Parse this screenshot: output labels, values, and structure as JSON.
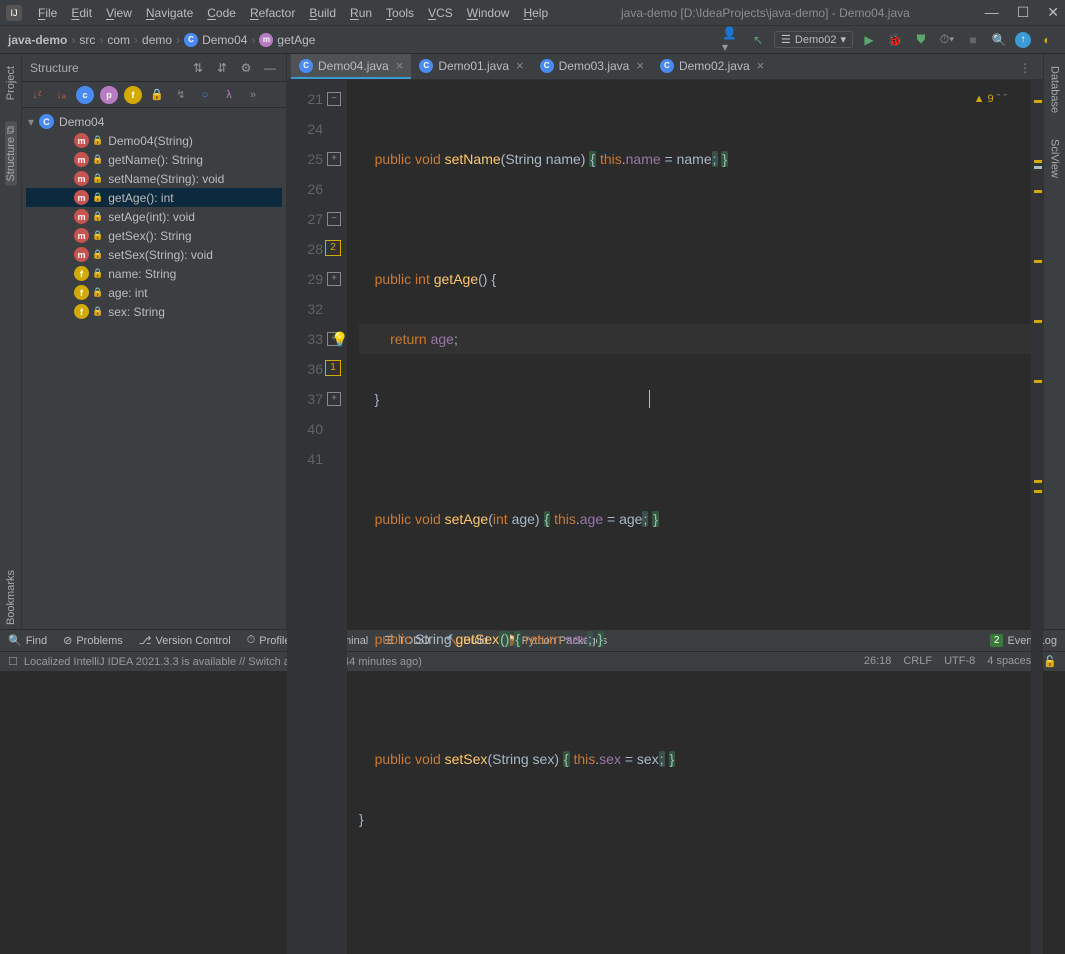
{
  "app": {
    "title": "java-demo [D:\\IdeaProjects\\java-demo] - Demo04.java"
  },
  "menu": [
    "File",
    "Edit",
    "View",
    "Navigate",
    "Code",
    "Refactor",
    "Build",
    "Run",
    "Tools",
    "VCS",
    "Window",
    "Help"
  ],
  "breadcrumb": {
    "project": "java-demo",
    "parts": [
      "src",
      "com",
      "demo"
    ],
    "class": "Demo04",
    "method": "getAge"
  },
  "runconfig": "Demo02",
  "warn_count": "9",
  "structure": {
    "title": "Structure",
    "class": "Demo04",
    "members": [
      {
        "t": "m",
        "label": "Demo04(String)"
      },
      {
        "t": "m",
        "label": "getName(): String"
      },
      {
        "t": "m",
        "label": "setName(String): void"
      },
      {
        "t": "m",
        "label": "getAge(): int",
        "sel": true
      },
      {
        "t": "m",
        "label": "setAge(int): void"
      },
      {
        "t": "m",
        "label": "getSex(): String"
      },
      {
        "t": "m",
        "label": "setSex(String): void"
      },
      {
        "t": "f",
        "label": "name: String"
      },
      {
        "t": "f",
        "label": "age: int"
      },
      {
        "t": "f",
        "label": "sex: String"
      }
    ]
  },
  "tabs": [
    {
      "name": "Demo04.java",
      "active": true
    },
    {
      "name": "Demo01.java"
    },
    {
      "name": "Demo03.java"
    },
    {
      "name": "Demo02.java"
    }
  ],
  "lines": [
    "21",
    "24",
    "25",
    "26",
    "27",
    "28",
    "29",
    "32",
    "33",
    "36",
    "37",
    "40",
    "41"
  ],
  "bottom": [
    "Find",
    "Problems",
    "Version Control",
    "Profiler",
    "Terminal",
    "TODO",
    "Build",
    "Python Packages"
  ],
  "eventlog": {
    "count": "2",
    "label": "Event Log"
  },
  "status": {
    "msg": "Localized IntelliJ IDEA 2021.3.3 is available // Switch and restart (44 minutes ago)",
    "pos": "26:18",
    "eol": "CRLF",
    "enc": "UTF-8",
    "indent": "4 spaces"
  }
}
